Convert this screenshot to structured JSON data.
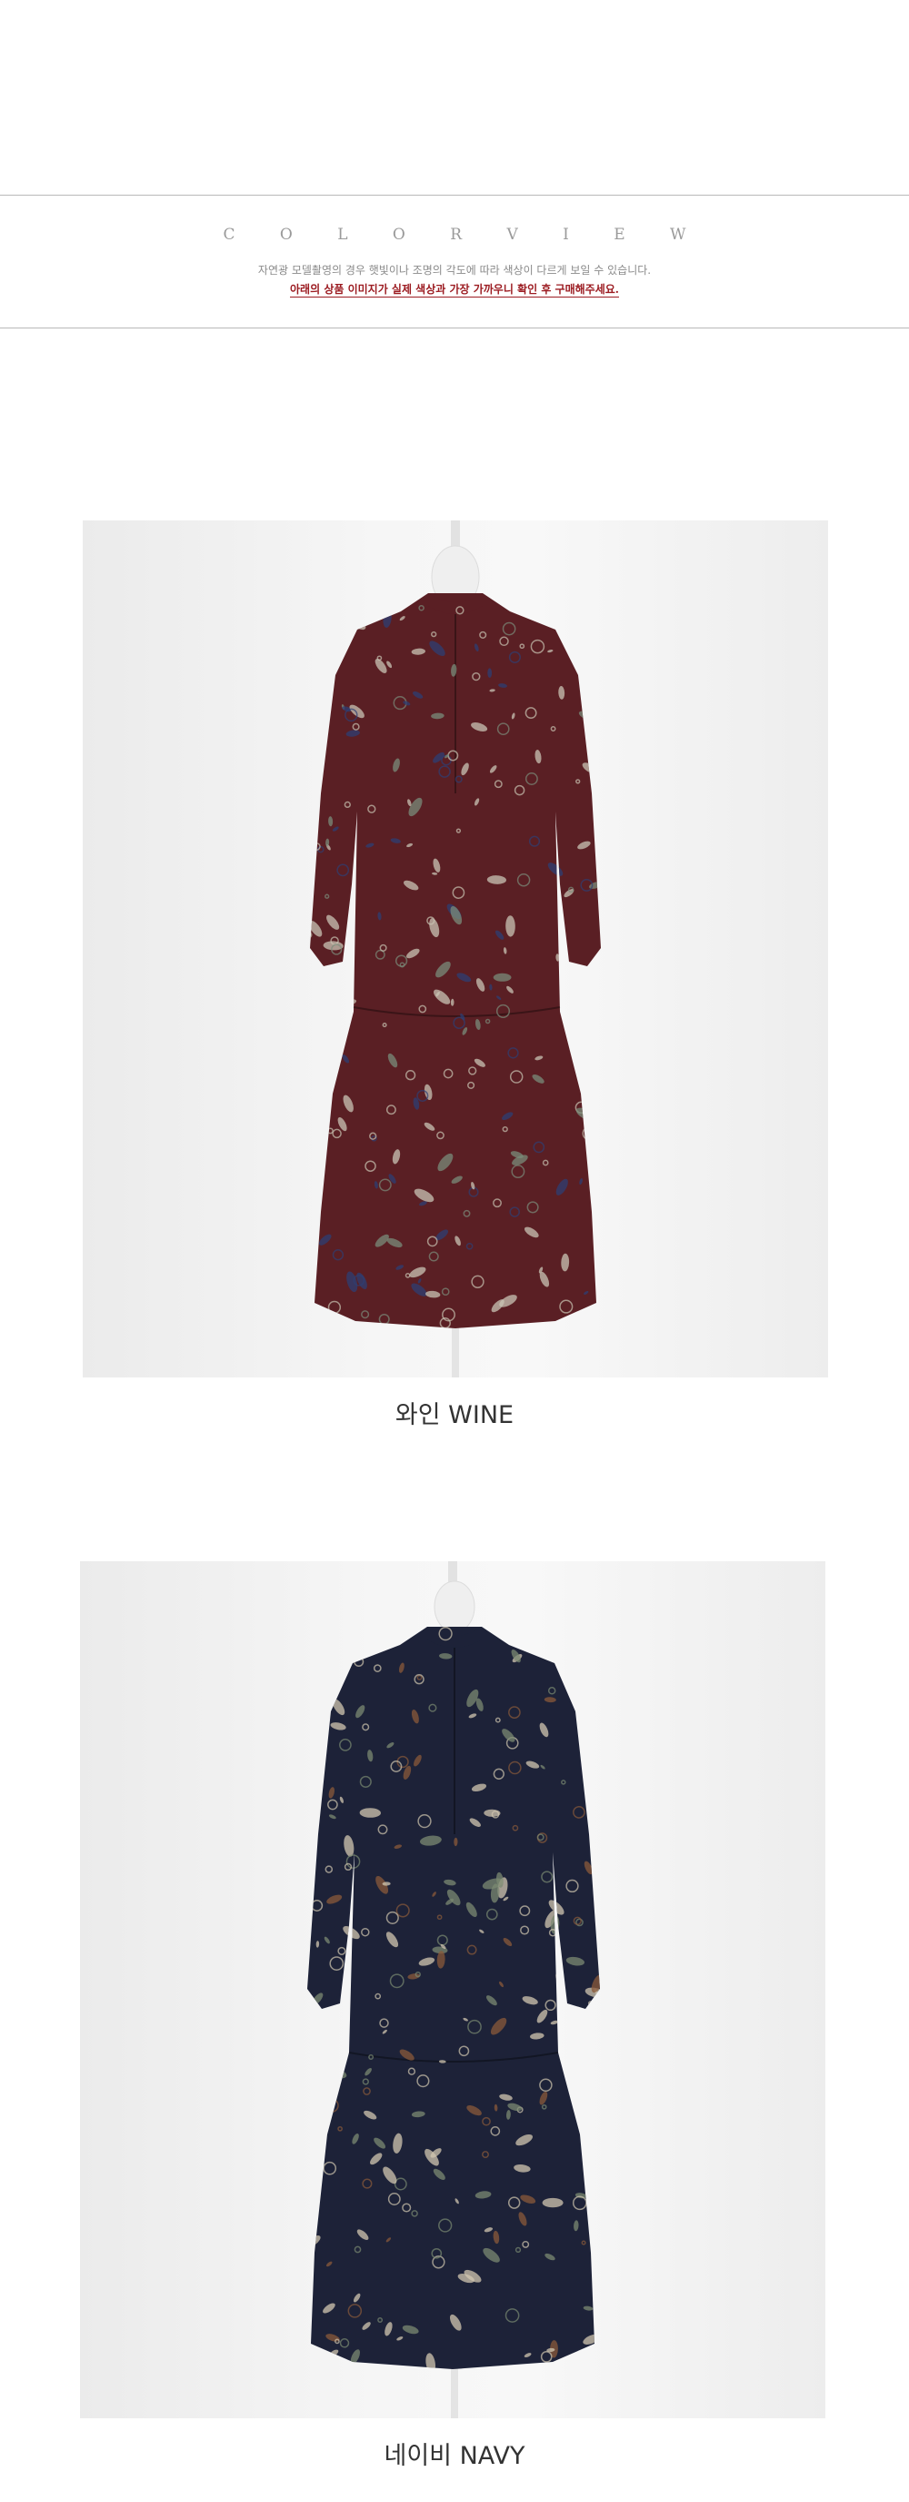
{
  "header": {
    "title": "C O L O R    V I E W",
    "notice_line_1": "자연광 모델촬영의 경우 햇빛이나 조명의 각도에 따라 색상이 다르게 보일 수 있습니다.",
    "notice_line_2": "아래의 상품 이미지가 실제 색상과 가장 가까우니 확인 후 구매해주세요."
  },
  "colors": [
    {
      "caption": "와인 WINE",
      "dress_base": "#5a1f24",
      "print_light": "#c9c4b4",
      "print_accent": "#2e3f73",
      "print_green": "#7a8c7a"
    },
    {
      "caption": "네이비 NAVY",
      "dress_base": "#1d2238",
      "print_light": "#d1c7b0",
      "print_accent": "#8a5a3a",
      "print_green": "#7b8a72"
    }
  ],
  "accent_color": "#9c1c22"
}
